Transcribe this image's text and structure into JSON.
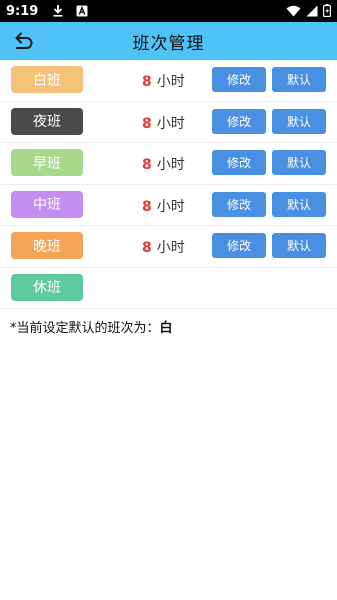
{
  "status_bar": {
    "time": "9:19"
  },
  "header": {
    "title": "班次管理"
  },
  "shifts": [
    {
      "name": "白班",
      "color": "#f5c27a",
      "hours": "8",
      "unit": "小时",
      "edit_label": "修改",
      "default_label": "默认"
    },
    {
      "name": "夜班",
      "color": "#4a4a4a",
      "hours": "8",
      "unit": "小时",
      "edit_label": "修改",
      "default_label": "默认"
    },
    {
      "name": "早班",
      "color": "#a8d88a",
      "hours": "8",
      "unit": "小时",
      "edit_label": "修改",
      "default_label": "默认"
    },
    {
      "name": "中班",
      "color": "#c38ef0",
      "hours": "8",
      "unit": "小时",
      "edit_label": "修改",
      "default_label": "默认"
    },
    {
      "name": "晚班",
      "color": "#f4a457",
      "hours": "8",
      "unit": "小时",
      "edit_label": "修改",
      "default_label": "默认"
    },
    {
      "name": "休班",
      "color": "#5fc99f"
    }
  ],
  "footer": {
    "label": "*当前设定默认的班次为：",
    "value": "白"
  }
}
